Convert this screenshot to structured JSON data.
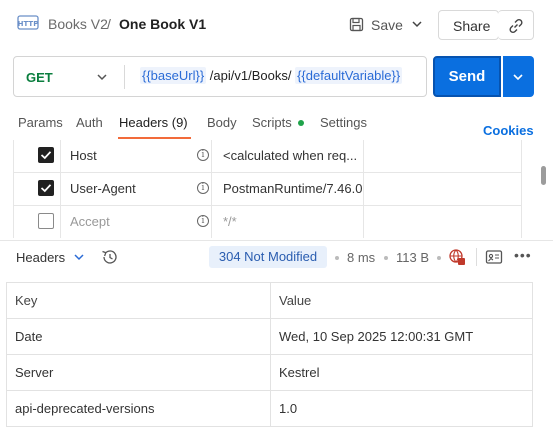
{
  "breadcrumb": {
    "parent": "Books V2",
    "separator": "/",
    "current": "One Book V1"
  },
  "toolbar": {
    "save_label": "Save",
    "share_label": "Share"
  },
  "request": {
    "method": "GET",
    "url_var1": "{{baseUrl}}",
    "url_path": "/api/v1/Books/",
    "url_var2": "{{defaultVariable}}",
    "send_label": "Send"
  },
  "tabs": [
    {
      "label": "Params"
    },
    {
      "label": "Auth"
    },
    {
      "label": "Headers (9)"
    },
    {
      "label": "Body"
    },
    {
      "label": "Scripts"
    },
    {
      "label": "Settings"
    }
  ],
  "cookies_label": "Cookies",
  "request_headers": [
    {
      "checked": true,
      "key": "Host",
      "value": "<calculated when req..."
    },
    {
      "checked": true,
      "key": "User-Agent",
      "value": "PostmanRuntime/7.46.0"
    },
    {
      "checked": false,
      "key": "Accept",
      "value": "*/*"
    }
  ],
  "response": {
    "view_label": "Headers",
    "status": "304 Not Modified",
    "time": "8 ms",
    "size": "113 B",
    "columns": {
      "key": "Key",
      "value": "Value"
    },
    "headers": [
      {
        "key": "Date",
        "value": "Wed, 10 Sep 2025 12:00:31 GMT"
      },
      {
        "key": "Server",
        "value": "Kestrel"
      },
      {
        "key": "api-deprecated-versions",
        "value": "1.0"
      }
    ]
  },
  "colors": {
    "accent": "#0a6fe0",
    "method_get": "#0a7e3e",
    "tab_underline": "#f26b3a",
    "scripts_dot": "#1fa34a",
    "globe_icon": "#c0392b"
  }
}
